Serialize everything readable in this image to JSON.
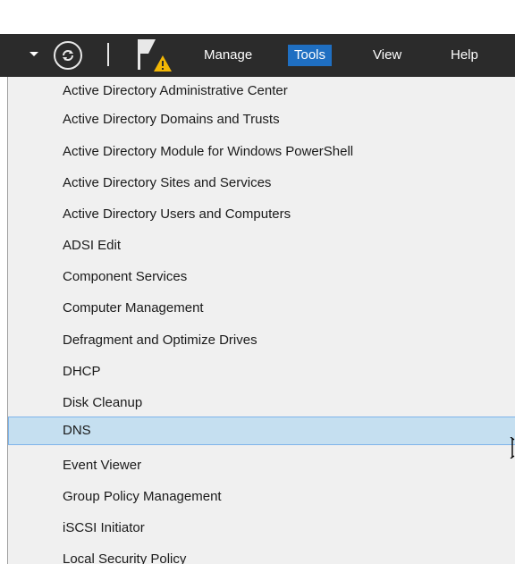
{
  "menubar": {
    "items": [
      "Manage",
      "Tools",
      "View",
      "Help"
    ],
    "active": "Tools"
  },
  "tools_menu": {
    "items": [
      "Active Directory Administrative Center",
      "Active Directory Domains and Trusts",
      "Active Directory Module for Windows PowerShell",
      "Active Directory Sites and Services",
      "Active Directory Users and Computers",
      "ADSI Edit",
      "Component Services",
      "Computer Management",
      "Defragment and Optimize Drives",
      "DHCP",
      "Disk Cleanup",
      "DNS",
      "Event Viewer",
      "Group Policy Management",
      "iSCSI Initiator",
      "Local Security Policy"
    ],
    "highlighted": "DNS"
  },
  "icons": {
    "dropdown": "chevron-down-icon",
    "refresh": "refresh-icon",
    "notifications": "flag-warning-icon"
  },
  "colors": {
    "toolbar_bg": "#2b2b2b",
    "active_menu": "#1f6fc2",
    "menu_bg": "#f0f0f0",
    "highlight": "#c5dff0",
    "warning": "#f2b705"
  }
}
